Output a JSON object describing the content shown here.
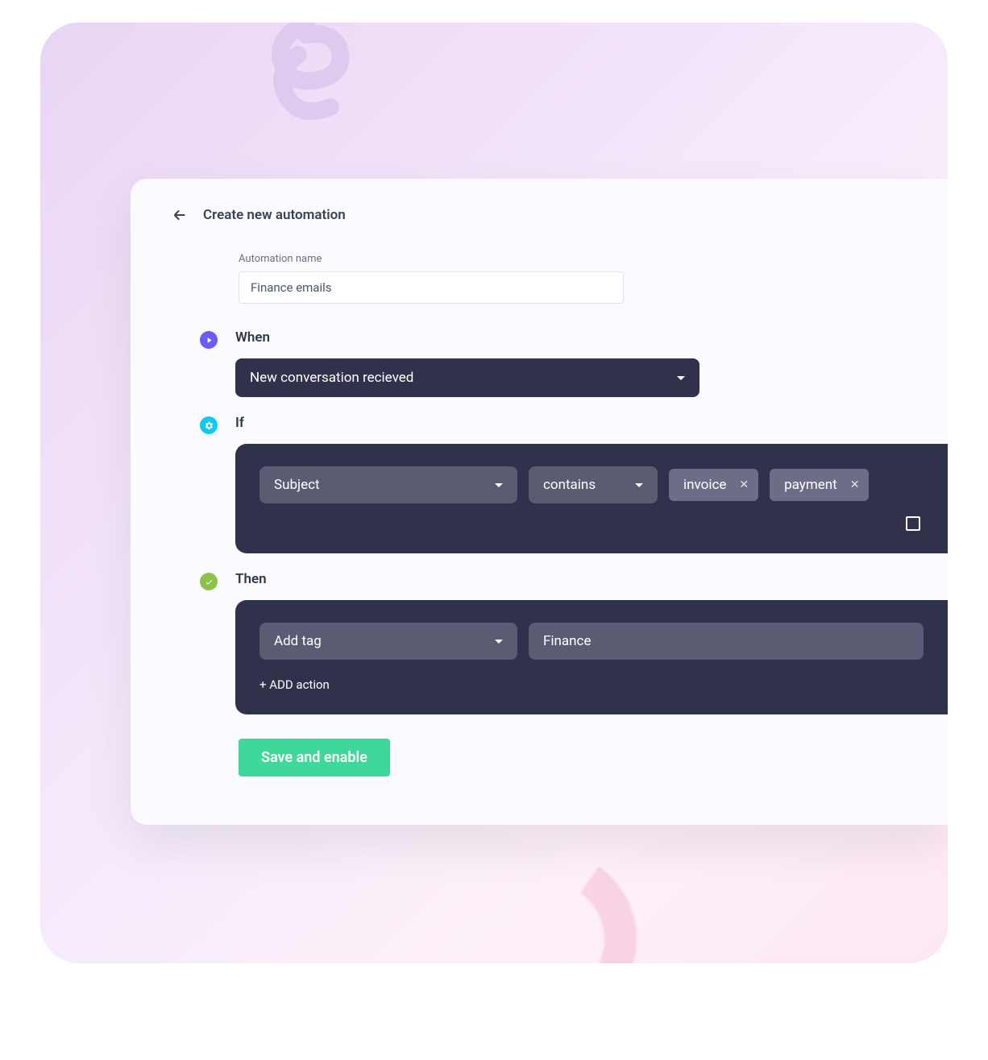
{
  "header": {
    "title": "Create new automation"
  },
  "name_field": {
    "label": "Automation name",
    "value": "Finance emails"
  },
  "when": {
    "label": "When",
    "trigger": "New conversation recieved"
  },
  "if": {
    "label": "If",
    "field": "Subject",
    "operator": "contains",
    "tags": [
      "invoice",
      "payment"
    ]
  },
  "then": {
    "label": "Then",
    "action": "Add tag",
    "value": "Finance",
    "add_action_label": "+ ADD action"
  },
  "save_button": "Save and enable"
}
